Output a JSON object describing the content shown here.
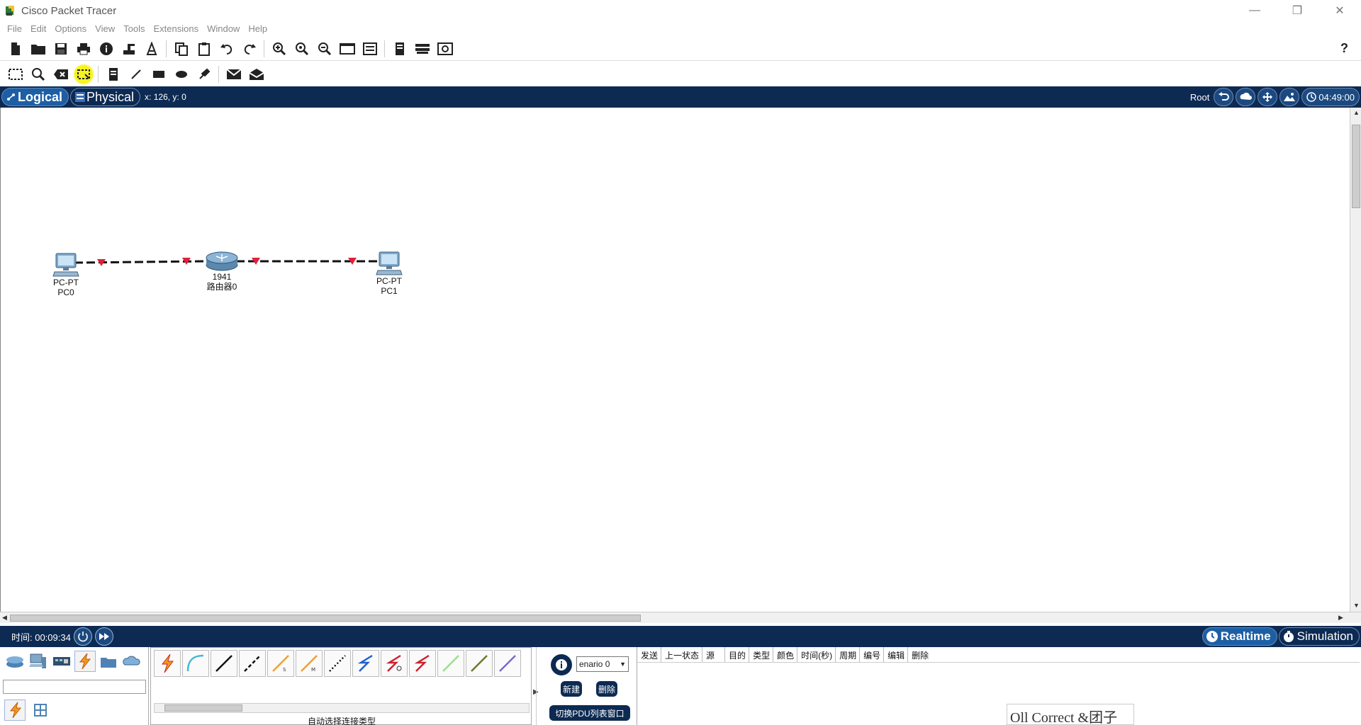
{
  "window": {
    "title": "Cisco Packet Tracer",
    "minimize": "—",
    "restore": "❐",
    "close": "✕"
  },
  "menu": [
    "File",
    "Edit",
    "Options",
    "View",
    "Tools",
    "Extensions",
    "Window",
    "Help"
  ],
  "toolbar_main": {
    "buttons": [
      "new-file",
      "open-folder",
      "save",
      "print",
      "info",
      "activity-wizard",
      "python-lab",
      "copy",
      "paste",
      "undo",
      "redo",
      "zoom-in",
      "zoom-reset",
      "zoom-out",
      "drawing-palette",
      "custom-device",
      "view-command-log",
      "cluster",
      "screenshot"
    ],
    "help_label": "?"
  },
  "toolbar_tools": {
    "buttons": [
      "select",
      "inspect",
      "delete",
      "resize-shape",
      "place-note",
      "draw-line",
      "draw-rectangle",
      "draw-ellipse",
      "freeform",
      "add-simple-pdu",
      "add-complex-pdu"
    ],
    "active": "resize-shape"
  },
  "workspace": {
    "logical_label": "Logical",
    "physical_label": "Physical",
    "coords": "x: 126, y: 0",
    "root_label": "Root",
    "clock": "04:49:00"
  },
  "topology": {
    "devices": [
      {
        "id": "pc0",
        "type": "PC-PT",
        "name": "PC0"
      },
      {
        "id": "router0",
        "type": "1941",
        "name": "路由器0"
      },
      {
        "id": "pc1",
        "type": "PC-PT",
        "name": "PC1"
      }
    ],
    "link_color": "#111111",
    "port_marker_color": "#e0203a"
  },
  "simulation": {
    "time_label": "时间: 00:09:34",
    "realtime_label": "Realtime",
    "simulation_label": "Simulation"
  },
  "device_panel": {
    "search_value": "",
    "connection_type_label": "自动选择连接类型"
  },
  "pdu_controls": {
    "scenario_value": "enario 0",
    "new_label": "新建",
    "delete_label": "删除",
    "toggle_label": "切换PDU列表窗口"
  },
  "pdu_list": {
    "columns": [
      "发送",
      "上一状态",
      "源",
      "目的",
      "类型",
      "颜色",
      "时间(秒)",
      "周期",
      "编号",
      "编辑",
      "删除"
    ]
  },
  "overlay": {
    "text": "Oll Correct &团子"
  },
  "colors": {
    "navy": "#0d2a52",
    "accent_blue": "#1c5fa5",
    "highlight_yellow": "#f7f320"
  }
}
